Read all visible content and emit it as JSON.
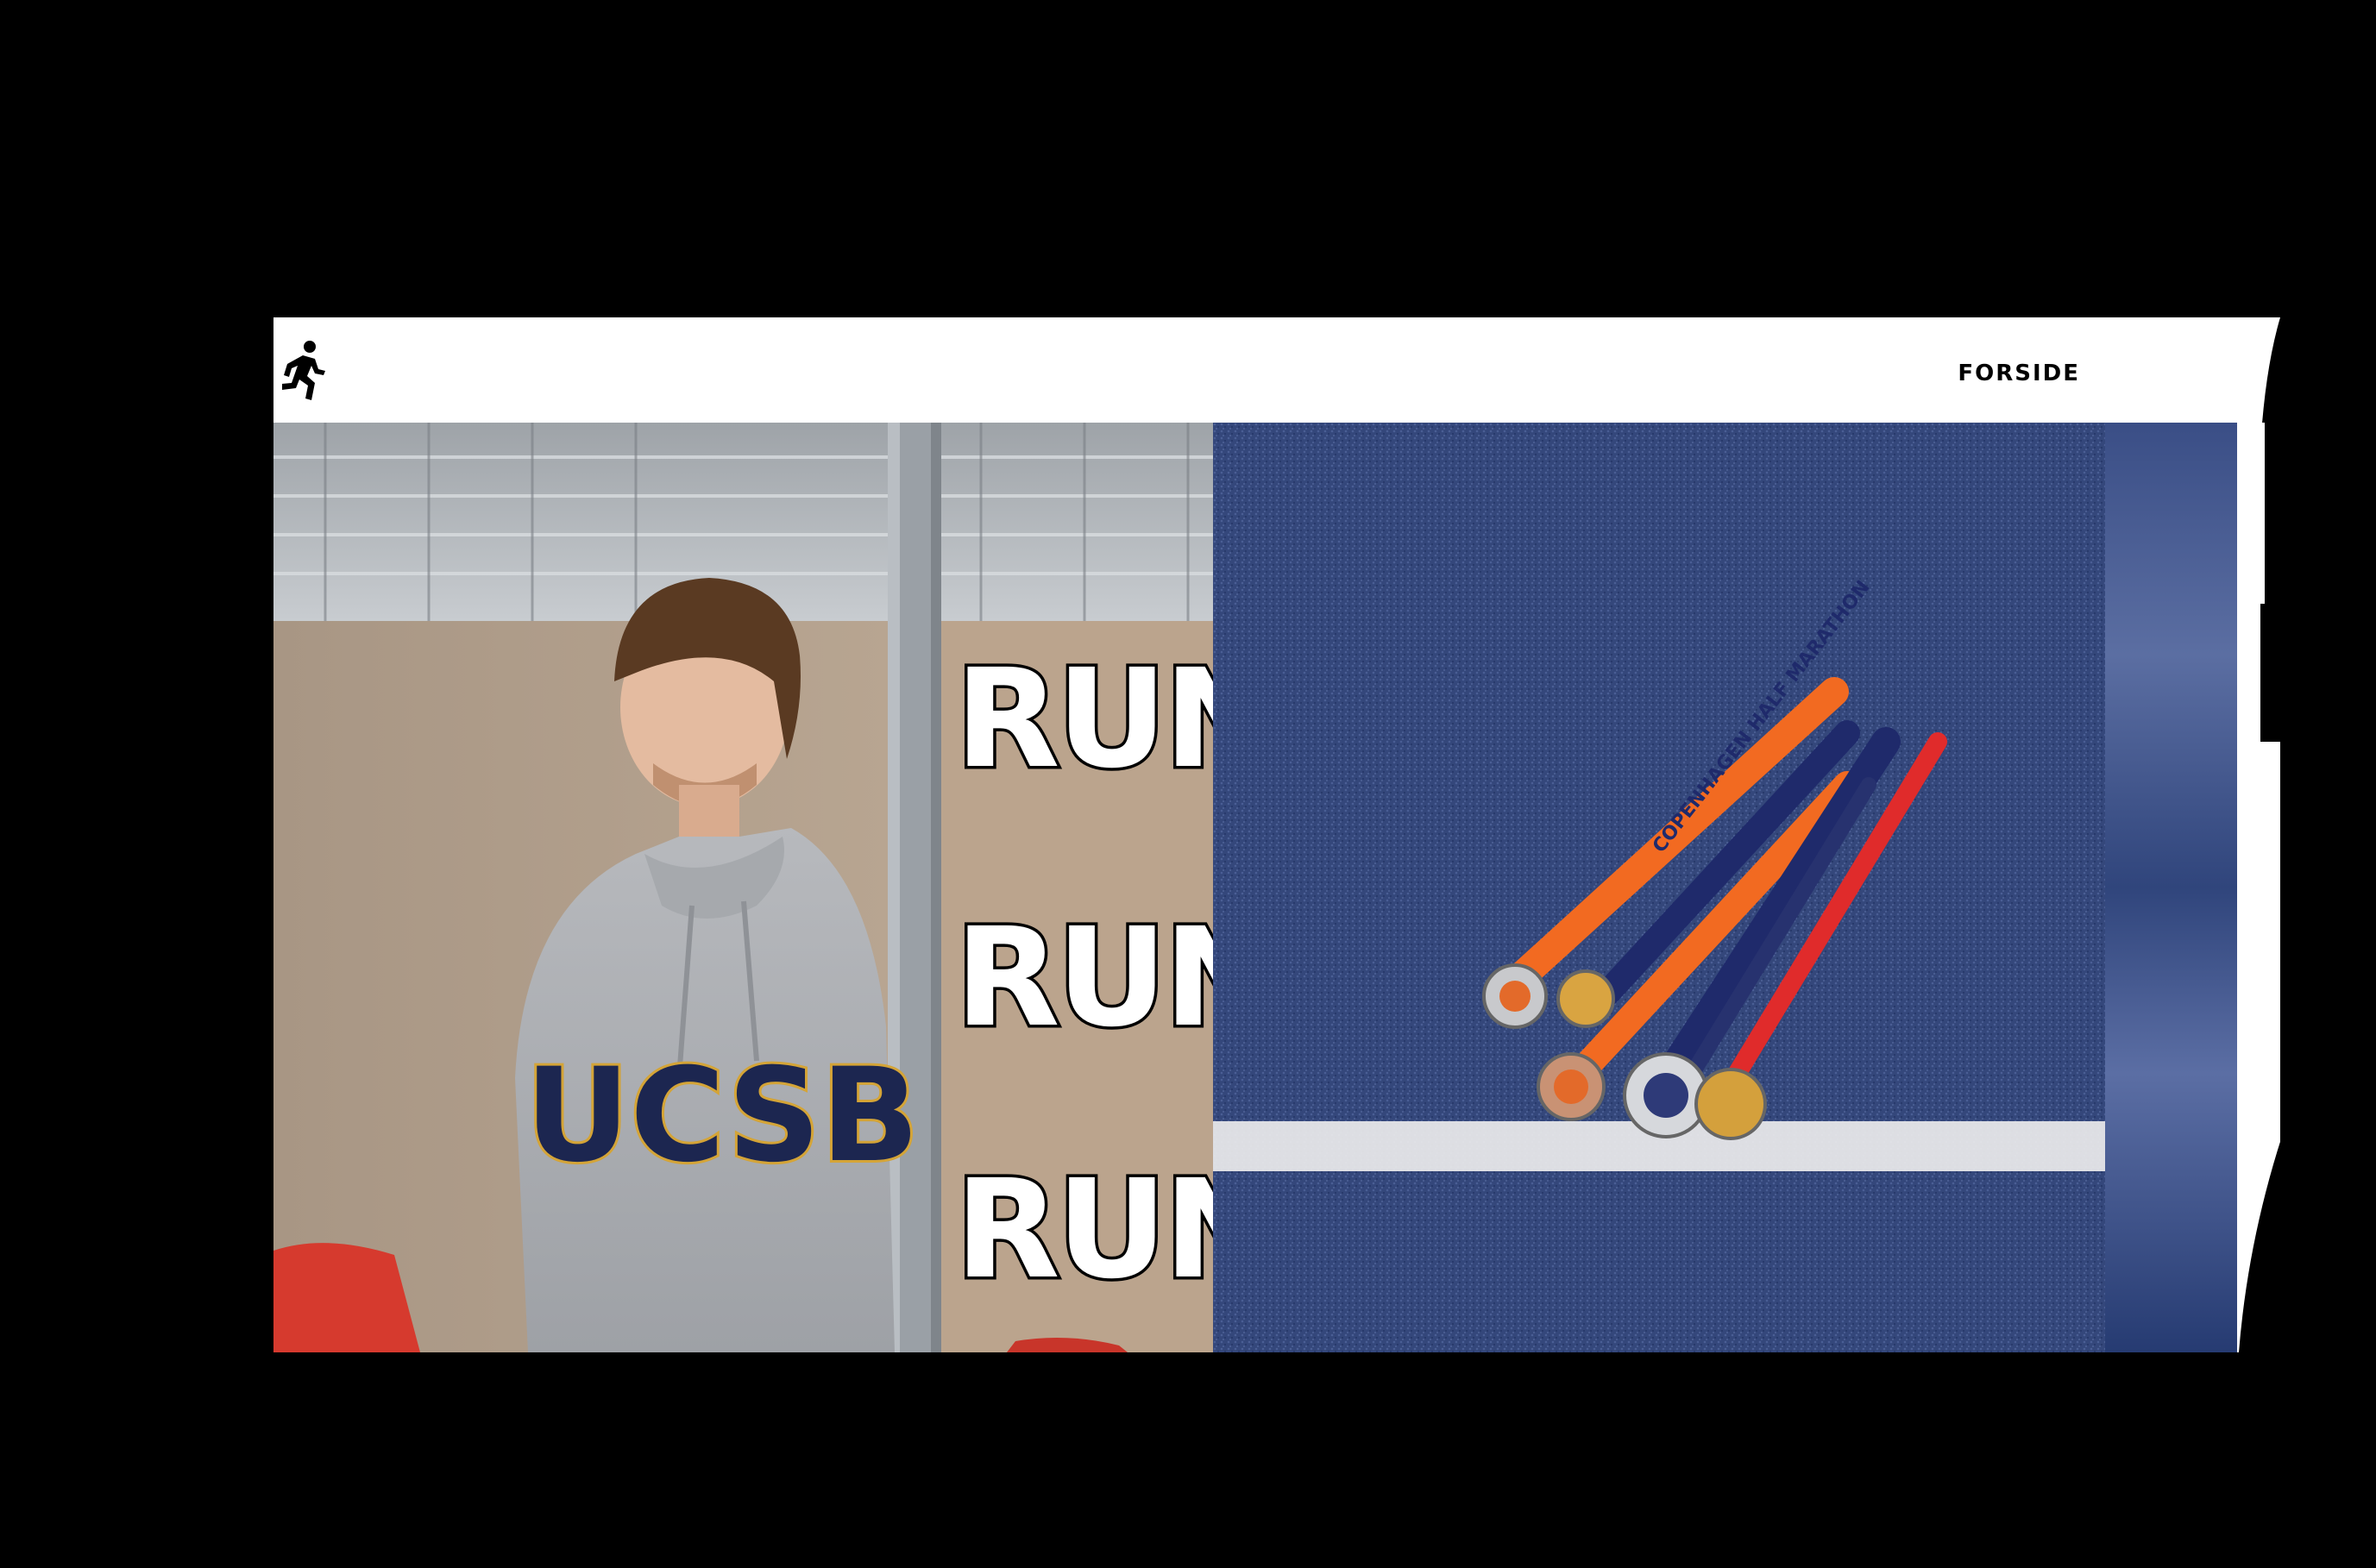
{
  "header": {
    "logo_icon": "running-person-icon",
    "nav": [
      {
        "label": "FORSIDE"
      }
    ]
  },
  "hero": {
    "left_image": {
      "overlay_words": [
        "RUN",
        "RUN",
        "RUN"
      ],
      "hoodie_text": "UCSB"
    },
    "right_image": {
      "ribbon_text": "COPENHAGEN HALF MARATHON"
    }
  },
  "colors": {
    "background": "#000000",
    "header_bg": "#ffffff",
    "track_blue": "#34477b",
    "lane_line": "#f2f2f2",
    "ribbon_orange": "#f26a21",
    "ribbon_navy": "#1f2a6b",
    "ribbon_red": "#e02b2b"
  }
}
